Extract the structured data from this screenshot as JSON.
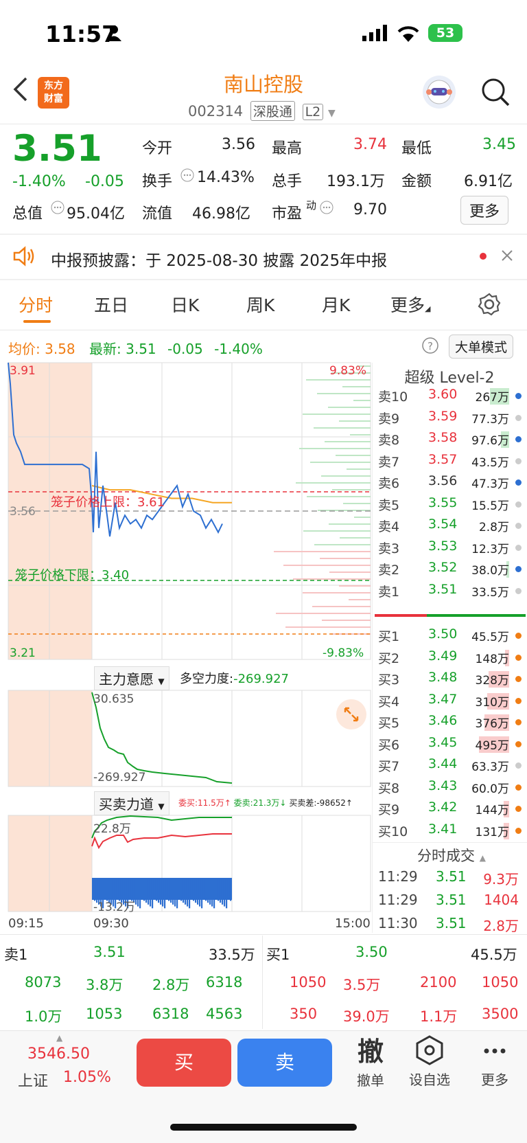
{
  "status_bar": {
    "time": "11:57",
    "battery": "53"
  },
  "header": {
    "title": "南山控股",
    "code": "002314",
    "tag_market": "深股通",
    "tag_level": "L2",
    "logo_line1": "东方",
    "logo_line2": "财富"
  },
  "quote": {
    "price": "3.51",
    "pct": "-1.40%",
    "change": "-0.05",
    "open_label": "今开",
    "open": "3.56",
    "high_label": "最高",
    "high": "3.74",
    "low_label": "最低",
    "low": "3.45",
    "turnover_label": "换手",
    "turnover": "14.43%",
    "volume_label": "总手",
    "volume": "193.1万",
    "amount_label": "金额",
    "amount": "6.91亿",
    "mcap_label": "总值",
    "mcap": "95.04亿",
    "float_label": "流值",
    "float": "46.98亿",
    "pe_label": "市盈",
    "pe_sup": "动",
    "pe": "9.70",
    "more_button": "更多"
  },
  "notice": {
    "text": "中报预披露：于 2025-08-30 披露 2025年中报"
  },
  "tabs": [
    "分时",
    "五日",
    "日K",
    "周K",
    "月K",
    "更多"
  ],
  "chart_header": {
    "avg_label": "均价:",
    "avg": "3.58",
    "latest_label": "最新:",
    "latest": "3.51",
    "latest_change": "-0.05",
    "latest_pct": "-1.40%",
    "mode_button": "大单模式"
  },
  "chart_labels": {
    "top_price": "3.91",
    "top_pct": "9.83%",
    "mid_price": "3.56",
    "bottom_price": "3.21",
    "bottom_pct": "-9.83%",
    "cage_upper": "笼子价格上限：3.61",
    "cage_lower": "笼子价格下限：3.40",
    "indicator1": "主力意愿",
    "indicator1_value_label": "多空力度:",
    "indicator1_value": "-269.927",
    "ind1_top": "30.635",
    "ind1_bottom": "-269.927",
    "indicator2": "买卖力道",
    "ind2_buy": "委买:11.5万↑",
    "ind2_sell": "委卖:21.3万↓",
    "ind2_diff": "买卖差:-98652↑",
    "ind2_top": "22.8万",
    "ind2_bottom": "-13.2万",
    "time_start": "09:15",
    "time_open": "09:30",
    "time_end": "15:00"
  },
  "chart_data": {
    "type": "line",
    "x_range": [
      "09:15",
      "15:00"
    ],
    "ylim": [
      3.21,
      3.91
    ],
    "series": [
      {
        "name": "最新",
        "values": [
          3.91,
          3.86,
          3.74,
          3.72,
          3.7,
          3.67,
          3.67,
          3.67,
          3.67,
          3.66,
          3.58,
          3.51,
          3.7,
          3.52,
          3.62,
          3.55,
          3.5,
          3.58,
          3.52,
          3.55,
          3.53,
          3.54,
          3.52,
          3.55,
          3.54,
          3.62,
          3.57,
          3.6,
          3.56,
          3.55,
          3.52,
          3.54,
          3.51,
          3.53
        ]
      },
      {
        "name": "均价",
        "values": [
          3.62,
          3.61,
          3.61,
          3.6,
          3.59,
          3.59,
          3.58,
          3.58
        ]
      }
    ],
    "ref_lines": {
      "prev_close": 3.56,
      "cage_upper": 3.61,
      "cage_lower": 3.4,
      "limit_down": 3.21
    }
  },
  "level2": {
    "title": "超级 Level-2",
    "asks": [
      {
        "label": "卖10",
        "price": "3.60",
        "vol": "267万"
      },
      {
        "label": "卖9",
        "price": "3.59",
        "vol": "77.3万"
      },
      {
        "label": "卖8",
        "price": "3.58",
        "vol": "97.6万"
      },
      {
        "label": "卖7",
        "price": "3.57",
        "vol": "43.5万"
      },
      {
        "label": "卖6",
        "price": "3.56",
        "vol": "47.3万"
      },
      {
        "label": "卖5",
        "price": "3.55",
        "vol": "15.5万"
      },
      {
        "label": "卖4",
        "price": "3.54",
        "vol": "2.8万"
      },
      {
        "label": "卖3",
        "price": "3.53",
        "vol": "12.3万"
      },
      {
        "label": "卖2",
        "price": "3.52",
        "vol": "38.0万"
      },
      {
        "label": "卖1",
        "price": "3.51",
        "vol": "33.5万"
      }
    ],
    "bids": [
      {
        "label": "买1",
        "price": "3.50",
        "vol": "45.5万"
      },
      {
        "label": "买2",
        "price": "3.49",
        "vol": "148万"
      },
      {
        "label": "买3",
        "price": "3.48",
        "vol": "328万"
      },
      {
        "label": "买4",
        "price": "3.47",
        "vol": "310万"
      },
      {
        "label": "买5",
        "price": "3.46",
        "vol": "376万"
      },
      {
        "label": "买6",
        "price": "3.45",
        "vol": "495万"
      },
      {
        "label": "买7",
        "price": "3.44",
        "vol": "63.3万"
      },
      {
        "label": "买8",
        "price": "3.43",
        "vol": "60.0万"
      },
      {
        "label": "买9",
        "price": "3.42",
        "vol": "144万"
      },
      {
        "label": "买10",
        "price": "3.41",
        "vol": "131万"
      }
    ],
    "ticks_title": "分时成交",
    "ticks": [
      {
        "time": "11:29",
        "price": "3.51",
        "vol": "9.3万"
      },
      {
        "time": "11:29",
        "price": "3.51",
        "vol": "1404"
      },
      {
        "time": "11:30",
        "price": "3.51",
        "vol": "2.8万"
      }
    ]
  },
  "queue": {
    "sell_label": "卖1",
    "sell_price": "3.51",
    "sell_vol": "33.5万",
    "buy_label": "买1",
    "buy_price": "3.50",
    "buy_vol": "45.5万",
    "sell_rows": [
      [
        "8073",
        "3.8万",
        "2.8万",
        "6318"
      ],
      [
        "1.0万",
        "1053",
        "6318",
        "4563"
      ]
    ],
    "buy_rows": [
      [
        "1050",
        "3.5万",
        "2100",
        "1050"
      ],
      [
        "350",
        "39.0万",
        "1.1万",
        "3500"
      ]
    ]
  },
  "bottom_bar": {
    "index_value": "3546.50",
    "index_name": "上证",
    "index_pct": "1.05%",
    "buy": "买",
    "sell": "卖",
    "cancel_icon": "撤",
    "cancel": "撤单",
    "watch": "设自选",
    "more": "更多"
  }
}
